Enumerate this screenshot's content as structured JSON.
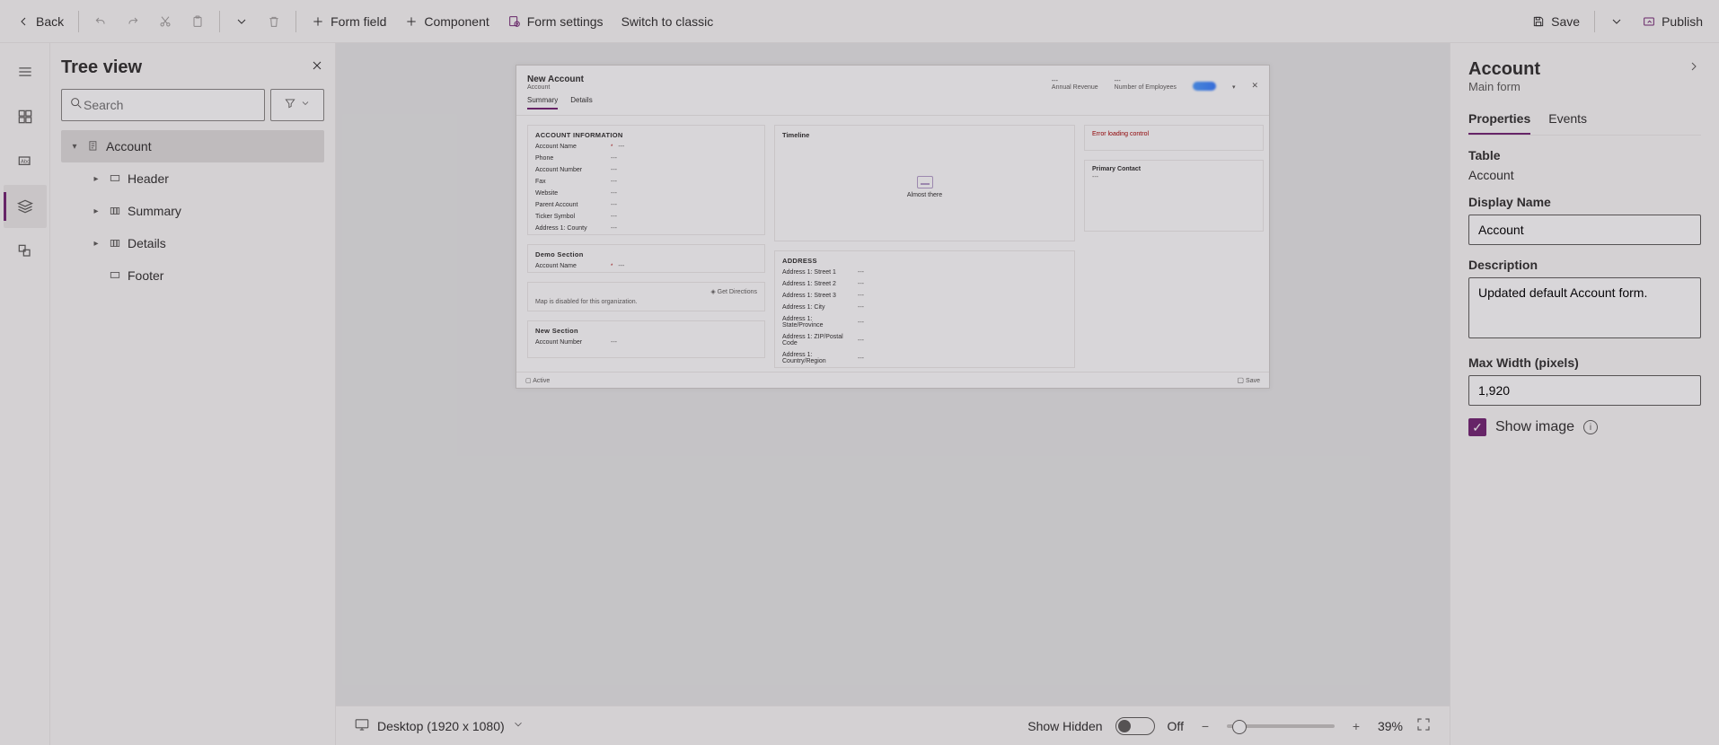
{
  "toolbar": {
    "back": "Back",
    "form_field": "Form field",
    "component": "Component",
    "form_settings": "Form settings",
    "switch_classic": "Switch to classic",
    "save": "Save",
    "publish": "Publish"
  },
  "tree": {
    "title": "Tree view",
    "search_placeholder": "Search",
    "nodes": {
      "root": "Account",
      "header": "Header",
      "summary": "Summary",
      "details": "Details",
      "footer": "Footer"
    }
  },
  "preview": {
    "title": "New Account",
    "subtitle": "Account",
    "header_fields": {
      "annual_rev": "Annual Revenue",
      "num_emp": "Number of Employees"
    },
    "tabs": {
      "summary": "Summary",
      "details": "Details"
    },
    "sections": {
      "account_info": "ACCOUNT INFORMATION",
      "demo": "Demo Section",
      "new_section": "New Section",
      "timeline": "Timeline",
      "address": "ADDRESS",
      "almost": "Almost there",
      "error_loading": "Error loading control",
      "primary_contact": "Primary Contact"
    },
    "fields": {
      "account_name": "Account Name",
      "phone": "Phone",
      "account_number": "Account Number",
      "fax": "Fax",
      "website": "Website",
      "parent_account": "Parent Account",
      "ticker": "Ticker Symbol",
      "addr1_county": "Address 1: County",
      "addr1_s1": "Address 1: Street 1",
      "addr1_s2": "Address 1: Street 2",
      "addr1_s3": "Address 1: Street 3",
      "addr1_city": "Address 1: City",
      "addr1_state": "Address 1: State/Province",
      "addr1_zip": "Address 1: ZIP/Postal Code",
      "addr1_country": "Address 1: Country/Region",
      "get_directions": "Get Directions",
      "map_disabled": "Map is disabled for this organization."
    },
    "dash": "---",
    "footer_active": "Active",
    "footer_save": "Save"
  },
  "status": {
    "viewport": "Desktop (1920 x 1080)",
    "show_hidden": "Show Hidden",
    "off": "Off",
    "zoom": "39%"
  },
  "props": {
    "title": "Account",
    "subtitle": "Main form",
    "tabs": {
      "properties": "Properties",
      "events": "Events"
    },
    "table_label": "Table",
    "table_value": "Account",
    "display_name_label": "Display Name",
    "display_name_value": "Account",
    "description_label": "Description",
    "description_value": "Updated default Account form.",
    "max_width_label": "Max Width (pixels)",
    "max_width_value": "1,920",
    "show_image": "Show image"
  }
}
